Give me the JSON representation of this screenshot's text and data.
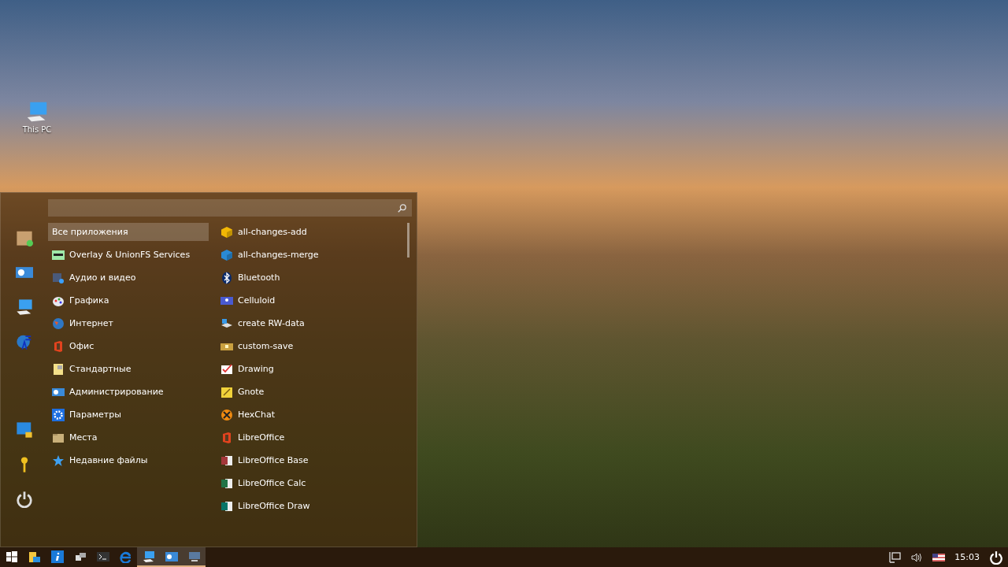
{
  "desktop_icons": [
    {
      "label": "This PC"
    }
  ],
  "menu": {
    "categories": [
      {
        "label": "Все приложения",
        "selected": true
      },
      {
        "label": "Overlay & UnionFS Services",
        "selected": false
      },
      {
        "label": "Аудио и видео",
        "selected": false
      },
      {
        "label": "Графика",
        "selected": false
      },
      {
        "label": "Интернет",
        "selected": false
      },
      {
        "label": "Офис",
        "selected": false
      },
      {
        "label": "Стандартные",
        "selected": false
      },
      {
        "label": "Администрирование",
        "selected": false
      },
      {
        "label": "Параметры",
        "selected": false
      },
      {
        "label": "Места",
        "selected": false
      },
      {
        "label": "Недавние файлы",
        "selected": false
      }
    ],
    "apps": [
      {
        "label": "all-changes-add"
      },
      {
        "label": "all-changes-merge"
      },
      {
        "label": "Bluetooth"
      },
      {
        "label": "Celluloid"
      },
      {
        "label": "create RW-data"
      },
      {
        "label": "custom-save"
      },
      {
        "label": "Drawing"
      },
      {
        "label": "Gnote"
      },
      {
        "label": "HexChat"
      },
      {
        "label": "LibreOffice"
      },
      {
        "label": "LibreOffice Base"
      },
      {
        "label": "LibreOffice Calc"
      },
      {
        "label": "LibreOffice Draw"
      }
    ]
  },
  "taskbar": {
    "items": [
      {
        "active": false
      },
      {
        "active": false
      },
      {
        "active": false
      },
      {
        "active": false
      },
      {
        "active": false
      },
      {
        "active": false
      },
      {
        "active": true
      },
      {
        "active": true
      },
      {
        "active": true
      }
    ],
    "clock": "15:03"
  }
}
